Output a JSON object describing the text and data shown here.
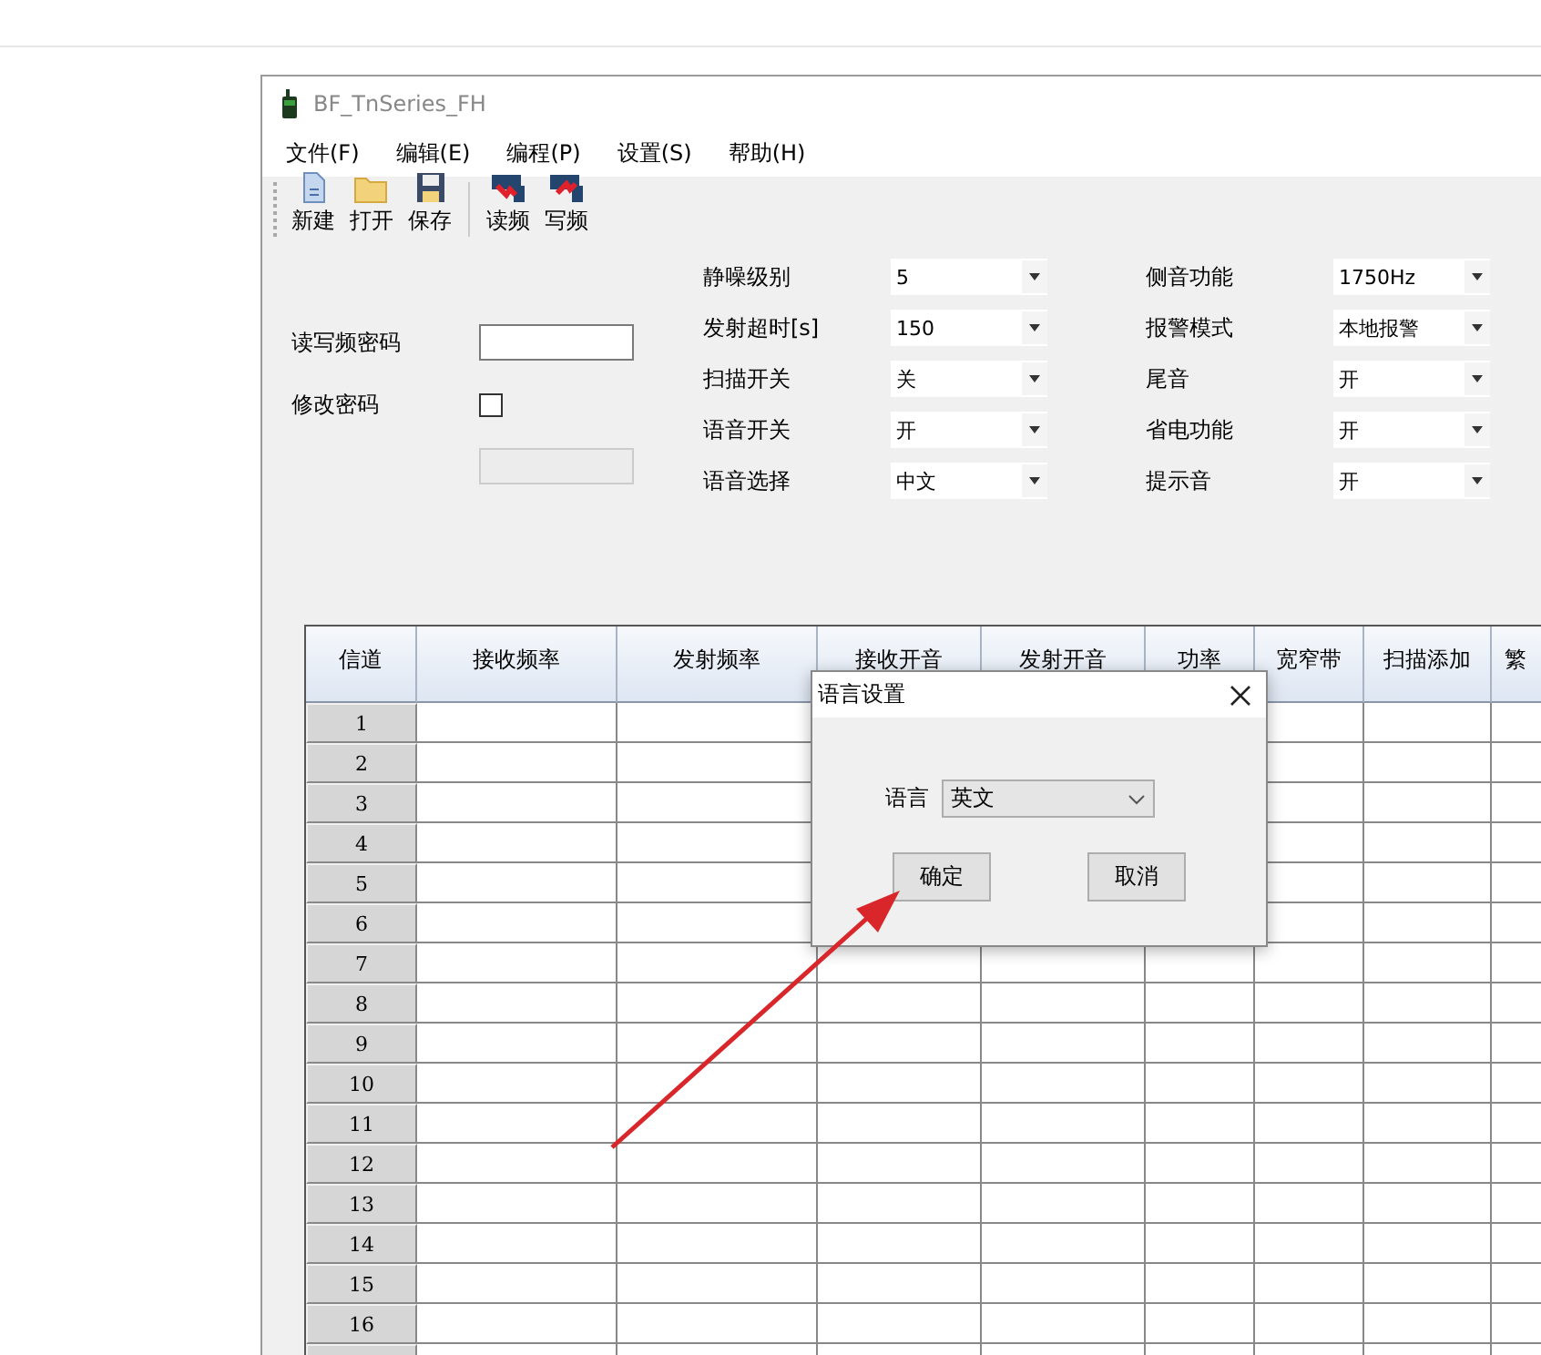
{
  "window": {
    "title": "BF_TnSeries_FH"
  },
  "menu": [
    {
      "label": "文件(F)"
    },
    {
      "label": "编辑(E)"
    },
    {
      "label": "编程(P)"
    },
    {
      "label": "设置(S)"
    },
    {
      "label": "帮助(H)"
    }
  ],
  "toolbar": [
    {
      "kind": "new",
      "label": "新建"
    },
    {
      "kind": "open",
      "label": "打开"
    },
    {
      "kind": "save",
      "label": "保存"
    },
    {
      "kind": "separator"
    },
    {
      "kind": "read",
      "label": "读频"
    },
    {
      "kind": "write",
      "label": "写频"
    }
  ],
  "password": {
    "label": "读写频密码",
    "change_label": "修改密码",
    "change_checked": false,
    "new_password_disabled": true
  },
  "settings_left": [
    {
      "label": "静噪级别",
      "value": "5"
    },
    {
      "label": "发射超时[s]",
      "value": "150"
    },
    {
      "label": "扫描开关",
      "value": "关"
    },
    {
      "label": "语音开关",
      "value": "开"
    },
    {
      "label": "语音选择",
      "value": "中文"
    }
  ],
  "settings_right": [
    {
      "label": "侧音功能",
      "value": "1750Hz"
    },
    {
      "label": "报警模式",
      "value": "本地报警"
    },
    {
      "label": "尾音",
      "value": "开"
    },
    {
      "label": "省电功能",
      "value": "开"
    },
    {
      "label": "提示音",
      "value": "开"
    }
  ],
  "table": {
    "columns": [
      "信道",
      "接收频率",
      "发射频率",
      "接收开音",
      "发射开音",
      "功率",
      "宽窄带",
      "扫描添加",
      "繁"
    ],
    "rows": [
      "1",
      "2",
      "3",
      "4",
      "5",
      "6",
      "7",
      "8",
      "9",
      "10",
      "11",
      "12",
      "13",
      "14",
      "15",
      "16"
    ]
  },
  "dialog": {
    "title": "语言设置",
    "language_label": "语言",
    "language_value": "英文",
    "buttons": [
      "确定",
      "取消"
    ]
  }
}
